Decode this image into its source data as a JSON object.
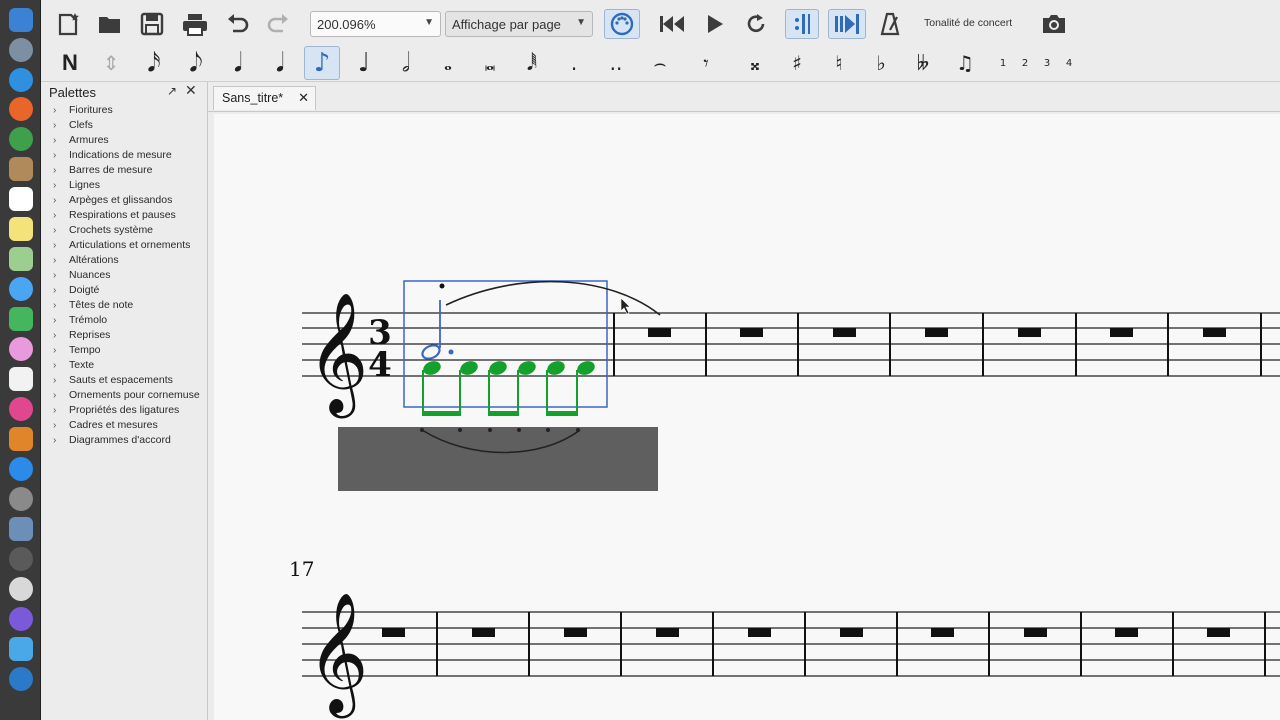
{
  "toolbar": {
    "zoom_value": "200.096%",
    "view_mode": "Affichage par page",
    "concert_pitch_label": "Tonalité de concert"
  },
  "note_input": {
    "voice_numbers": [
      "1",
      "2",
      "3",
      "4"
    ]
  },
  "palettes": {
    "title": "Palettes",
    "items": [
      "Fioritures",
      "Clefs",
      "Armures",
      "Indications de mesure",
      "Barres de mesure",
      "Lignes",
      "Arpèges et glissandos",
      "Respirations et pauses",
      "Crochets système",
      "Articulations et ornements",
      "Altérations",
      "Nuances",
      "Doigté",
      "Têtes de note",
      "Trémolo",
      "Reprises",
      "Tempo",
      "Texte",
      "Sauts et espacements",
      "Ornements pour cornemuse",
      "Propriétés des ligatures",
      "Cadres et mesures",
      "Diagrammes d'accord"
    ]
  },
  "tabs": {
    "active": "Sans_titre*"
  },
  "score": {
    "time_sig_top": "3",
    "time_sig_bottom": "4",
    "measure_number": "17"
  },
  "colors": {
    "selection_blue": "#3a66c4",
    "selected_note_green": "#14a02c",
    "dark_rect": "#5f5f5f"
  }
}
